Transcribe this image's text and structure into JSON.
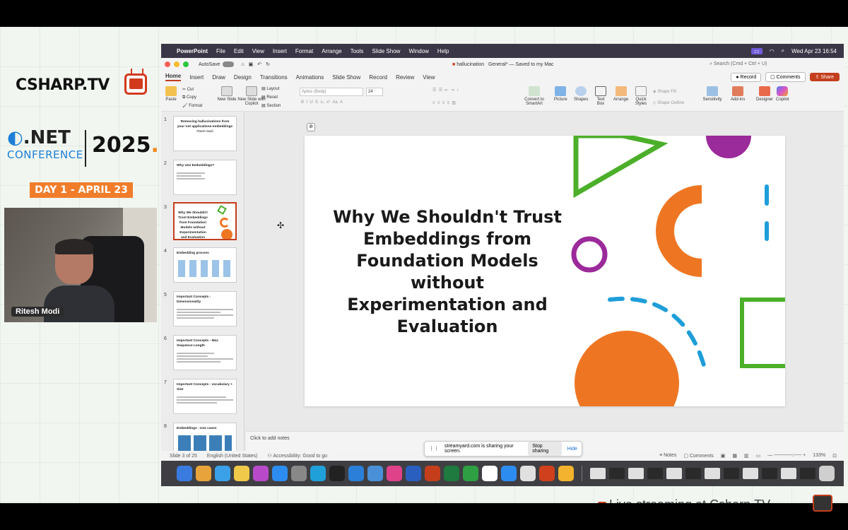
{
  "branding": {
    "site": "CSHARP.TV",
    "net": ".NET",
    "conference": "CONFERENCE",
    "year": "2025",
    "day": "DAY 1 - APRIL 23",
    "ticker": "Live streaming at Csharp.TV"
  },
  "webcam": {
    "speaker_name": "Ritesh Modi"
  },
  "menubar": {
    "app": "PowerPoint",
    "items": [
      "File",
      "Edit",
      "View",
      "Insert",
      "Format",
      "Arrange",
      "Tools",
      "Slide Show",
      "Window",
      "Help"
    ],
    "clock": "Wed Apr 23  16:54"
  },
  "titlebar": {
    "autosave": "AutoSave",
    "doc_name": "hallucination",
    "doc_status": "General* — Saved to my Mac",
    "search_placeholder": "Search (Cmd + Ctrl + U)"
  },
  "tabs": [
    "Home",
    "Insert",
    "Draw",
    "Design",
    "Transitions",
    "Animations",
    "Slide Show",
    "Record",
    "Review",
    "View"
  ],
  "tab_actions": {
    "record": "Record",
    "comments": "Comments",
    "share": "Share"
  },
  "ribbon": {
    "paste": "Paste",
    "cut": "Cut",
    "copy": "Copy",
    "format": "Format",
    "new_slide": "New Slide",
    "new_slide_copilot": "New Slide with Copilot",
    "layout": "Layout",
    "reset": "Reset",
    "section": "Section",
    "font": "Aptos (Body)",
    "font_size": "24",
    "convert": "Convert to SmartArt",
    "picture": "Picture",
    "shapes": "Shapes",
    "text_box": "Text Box",
    "arrange": "Arrange",
    "quick_styles": "Quick Styles",
    "shape_fill": "Shape Fill",
    "shape_outline": "Shape Outline",
    "sensitivity": "Sensitivity",
    "addins": "Add-ins",
    "designer": "Designer",
    "copilot": "Copilot"
  },
  "thumbnails": [
    {
      "num": "1",
      "title": "Removing hallucinations from your not applications-embeddings",
      "sub": "Ritesh Modi"
    },
    {
      "num": "2",
      "title": "Why Use Embeddings?",
      "sub": ""
    },
    {
      "num": "3",
      "title": "Why We Shouldn't Trust Embeddings from Foundation Models without Experimentation and Evaluation",
      "sub": ""
    },
    {
      "num": "4",
      "title": "Embedding process",
      "sub": ""
    },
    {
      "num": "5",
      "title": "Important Concepts - Dimensionality",
      "sub": ""
    },
    {
      "num": "6",
      "title": "Important Concepts - Max Sequence Length",
      "sub": ""
    },
    {
      "num": "7",
      "title": "Important Concepts - vocabulary + Size",
      "sub": ""
    },
    {
      "num": "8",
      "title": "Embeddings - Use cases",
      "sub": ""
    }
  ],
  "slide": {
    "title": "Why We Shouldn't Trust Embeddings from Foundation Models without Experimentation and Evaluation",
    "colors": {
      "green": "#4caf2a",
      "orange": "#ee7623",
      "purple": "#9b2a9a",
      "blue": "#1e9ed9"
    }
  },
  "notes": {
    "placeholder": "Click to add notes"
  },
  "status": {
    "slide_of": "Slide 3 of 25",
    "language": "English (United States)",
    "accessibility": "Accessibility: Good to go",
    "notes": "Notes",
    "comments": "Comments",
    "zoom": "133%"
  },
  "sharing": {
    "message": "streamyard.com is sharing your screen.",
    "stop": "Stop sharing",
    "hide": "Hide"
  },
  "dock_colors": [
    "#3a7be0",
    "#e8a33a",
    "#3aa0e8",
    "#f0c94a",
    "#b84ac9",
    "#2d8cf0",
    "#888",
    "#1fa0d8",
    "#222",
    "#2b7fd8",
    "#4a90d9",
    "#e0428a",
    "#2b5fbf",
    "#c43e1c",
    "#1e7a3e",
    "#2ea043",
    "#fff",
    "#2d8cf0",
    "#e0e0e0",
    "#d0401c",
    "#f3b32e"
  ]
}
